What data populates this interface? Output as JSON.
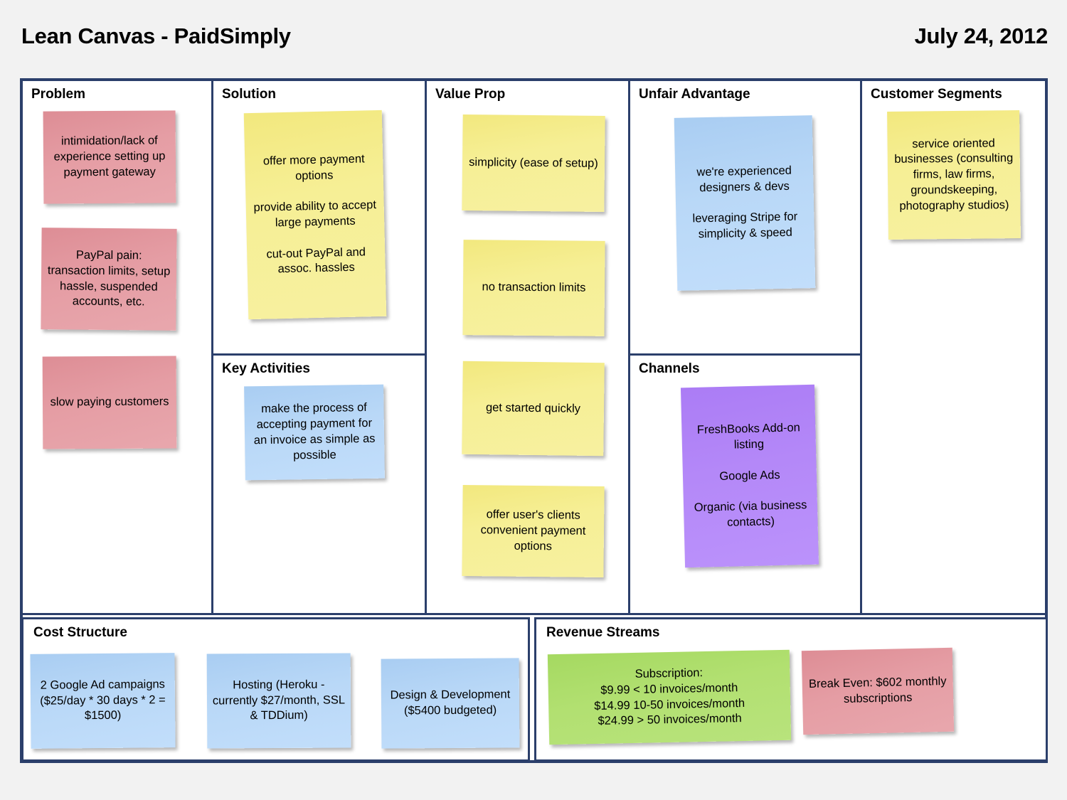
{
  "header": {
    "title": "Lean Canvas - PaidSimply",
    "date": "July 24, 2012"
  },
  "colors": {
    "frame": "#2b3f6b",
    "background": "#f2f2f2",
    "note_pink": "#e29aa1",
    "note_yellow": "#f5ee92",
    "note_blue": "#b7d7f6",
    "note_purple": "#b386f8",
    "note_green": "#b0de6f"
  },
  "sections": {
    "problem": {
      "title": "Problem",
      "notes": [
        {
          "color": "pink",
          "text": "intimidation/lack of experience setting up payment gateway"
        },
        {
          "color": "pink",
          "text": "PayPal pain: transaction limits, setup hassle, suspended accounts, etc."
        },
        {
          "color": "pink",
          "text": "slow paying customers"
        }
      ]
    },
    "solution": {
      "title": "Solution",
      "notes": [
        {
          "color": "yellow",
          "text": "offer more payment options\n\nprovide ability to accept large payments\n\ncut-out PayPal and assoc. hassles"
        }
      ]
    },
    "key_activities": {
      "title": "Key Activities",
      "notes": [
        {
          "color": "blue",
          "text": "make the process of accepting payment for an invoice as simple as possible"
        }
      ]
    },
    "value_prop": {
      "title": "Value Prop",
      "notes": [
        {
          "color": "yellow",
          "text": "simplicity (ease of setup)"
        },
        {
          "color": "yellow",
          "text": "no transaction limits"
        },
        {
          "color": "yellow",
          "text": "get started quickly"
        },
        {
          "color": "yellow",
          "text": "offer user's clients convenient payment options"
        }
      ]
    },
    "unfair_advantage": {
      "title": "Unfair Advantage",
      "notes": [
        {
          "color": "blue",
          "text": "we're experienced designers & devs\n\nleveraging Stripe for simplicity & speed"
        }
      ]
    },
    "channels": {
      "title": "Channels",
      "notes": [
        {
          "color": "purple",
          "text": "FreshBooks Add-on listing\n\nGoogle Ads\n\nOrganic (via business contacts)"
        }
      ]
    },
    "customer_segments": {
      "title": "Customer Segments",
      "notes": [
        {
          "color": "yellow",
          "text": "service oriented businesses (consulting firms, law firms, groundskeeping, photography studios)"
        }
      ]
    },
    "cost_structure": {
      "title": "Cost Structure",
      "notes": [
        {
          "color": "blue",
          "text": "2 Google Ad campaigns ($25/day * 30 days * 2 = $1500)"
        },
        {
          "color": "blue",
          "text": "Hosting (Heroku - currently $27/month, SSL & TDDium)"
        },
        {
          "color": "blue",
          "text": "Design & Development ($5400 budgeted)"
        }
      ]
    },
    "revenue_streams": {
      "title": "Revenue Streams",
      "notes": [
        {
          "color": "green",
          "text": "Subscription:\n$9.99 < 10 invoices/month\n$14.99 10-50 invoices/month\n$24.99 > 50 invoices/month"
        },
        {
          "color": "pink",
          "text": "Break Even: $602 monthly subscriptions"
        }
      ]
    }
  }
}
